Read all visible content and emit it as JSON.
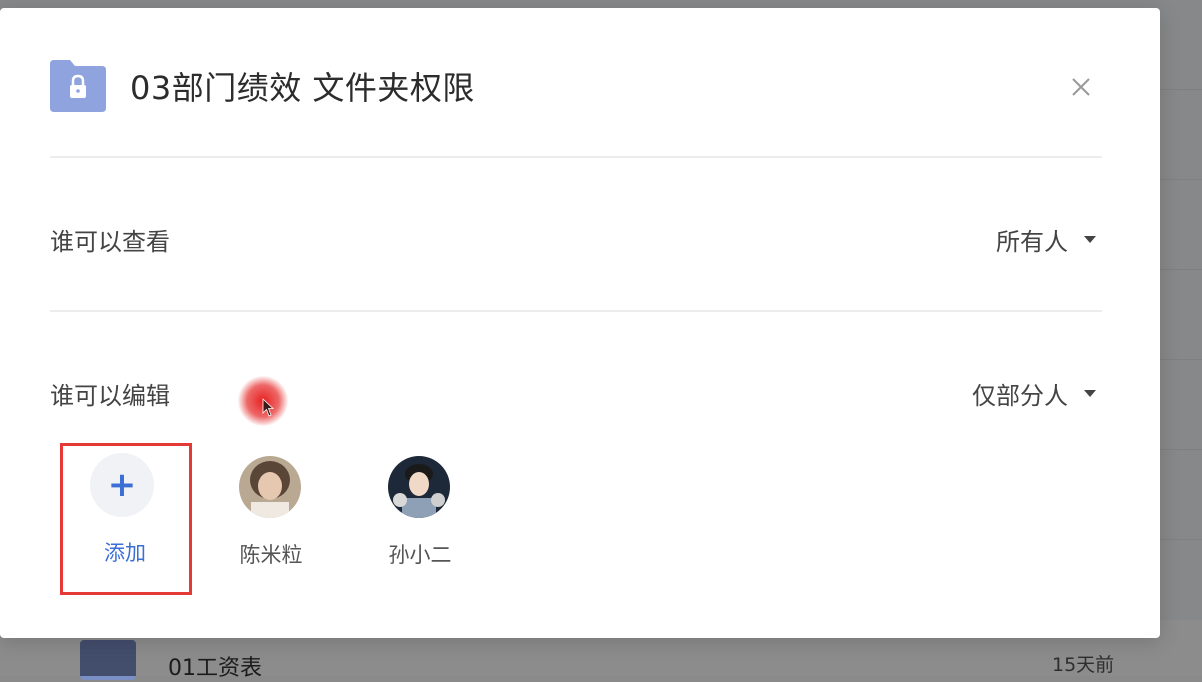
{
  "dialog": {
    "title": "03部门绩效 文件夹权限",
    "view_row": {
      "label": "谁可以查看",
      "value": "所有人"
    },
    "edit_row": {
      "label": "谁可以编辑",
      "value": "仅部分人"
    },
    "add_label": "添加",
    "members": [
      {
        "name": "陈米粒"
      },
      {
        "name": "孙小二"
      }
    ]
  },
  "background": {
    "file_name": "01工资表",
    "file_time": "15天前"
  },
  "colors": {
    "accent": "#3b6fd6",
    "folder_icon": "#8fa3de",
    "highlight_box": "#e53935"
  }
}
